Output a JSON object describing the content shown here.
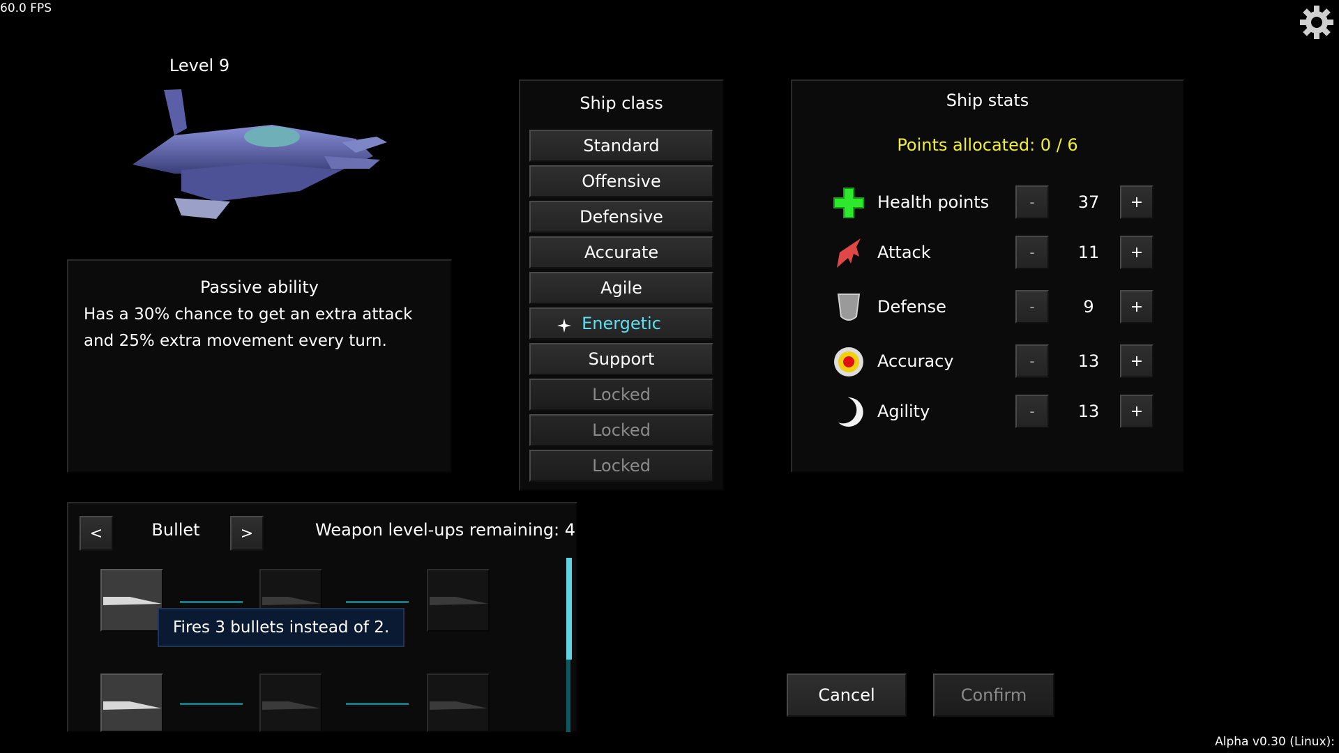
{
  "hud": {
    "fps": "60.0 FPS",
    "version": "Alpha v0.30 (Linux):"
  },
  "ship": {
    "level": "Level 9"
  },
  "passive": {
    "title": "Passive ability",
    "text": "Has a 30% chance to get an extra attack and 25% extra movement every turn."
  },
  "ship_class": {
    "title": "Ship class",
    "options": [
      "Standard",
      "Offensive",
      "Defensive",
      "Accurate",
      "Agile",
      "Energetic",
      "Support",
      "Locked",
      "Locked",
      "Locked"
    ],
    "selected": "Energetic"
  },
  "stats": {
    "title": "Ship stats",
    "points_allocated": "Points allocated: 0 / 6",
    "minus_label": "-",
    "plus_label": "+",
    "rows": [
      {
        "label": "Health points",
        "value": "37",
        "icon": "health-cross-icon"
      },
      {
        "label": "Attack",
        "value": "11",
        "icon": "attack-claw-icon"
      },
      {
        "label": "Defense",
        "value": "9",
        "icon": "defense-shield-icon"
      },
      {
        "label": "Accuracy",
        "value": "13",
        "icon": "accuracy-target-icon"
      },
      {
        "label": "Agility",
        "value": "13",
        "icon": "agility-moon-icon"
      }
    ],
    "accent_color": "#f1f02a"
  },
  "weapon": {
    "prev_label": "<",
    "next_label": ">",
    "name": "Bullet",
    "remaining": "Weapon level-ups remaining: 4",
    "tooltip": "Fires 3 bullets instead of 2."
  },
  "actions": {
    "cancel": "Cancel",
    "confirm": "Confirm"
  }
}
